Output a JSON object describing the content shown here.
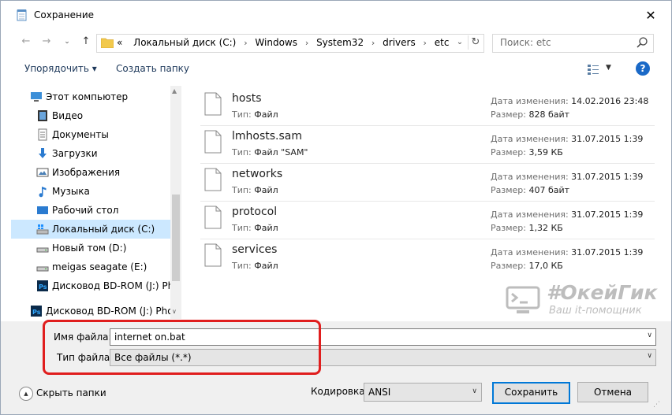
{
  "window": {
    "title": "Сохранение",
    "close_glyph": "✕"
  },
  "nav": {
    "back_glyph": "←",
    "forward_glyph": "→",
    "up_glyph": "↑",
    "breadcrumbs": [
      "«",
      "Локальный диск (C:)",
      "Windows",
      "System32",
      "drivers",
      "etc"
    ],
    "crumb_separator": "›",
    "refresh_glyph": "↻",
    "dropdown_glyph": "⌄",
    "search_placeholder": "Поиск: etc"
  },
  "toolbar": {
    "organize_label": "Упорядочить ▾",
    "new_folder_label": "Создать папку",
    "view_dropdown_glyph": "▼",
    "help_label": "?"
  },
  "sidebar": {
    "items": [
      {
        "label": "Этот компьютер",
        "icon": "computer-icon",
        "selected": false
      },
      {
        "label": "Видео",
        "icon": "video-folder-icon",
        "selected": false
      },
      {
        "label": "Документы",
        "icon": "documents-folder-icon",
        "selected": false
      },
      {
        "label": "Загрузки",
        "icon": "downloads-icon",
        "selected": false
      },
      {
        "label": "Изображения",
        "icon": "pictures-folder-icon",
        "selected": false
      },
      {
        "label": "Музыка",
        "icon": "music-icon",
        "selected": false
      },
      {
        "label": "Рабочий стол",
        "icon": "desktop-icon",
        "selected": false
      },
      {
        "label": "Локальный диск (C:)",
        "icon": "local-disk-icon",
        "selected": true
      },
      {
        "label": "Новый том (D:)",
        "icon": "drive-icon",
        "selected": false
      },
      {
        "label": "meigas seagate (E:)",
        "icon": "drive-icon",
        "selected": false
      },
      {
        "label": "Дисковод BD-ROM (J:) Phot",
        "icon": "photoshop-icon",
        "selected": false
      },
      {
        "label": "Дисковод BD-ROM (J:) Photo",
        "icon": "photoshop-icon",
        "selected": false
      }
    ],
    "scroll_up_glyph": "▲",
    "scroll_down_glyph": "∨"
  },
  "files": {
    "modified_label": "Дата изменения:",
    "size_label": "Размер:",
    "type_label": "Тип:",
    "items": [
      {
        "name": "hosts",
        "type": "Файл",
        "modified": "14.02.2016 23:48",
        "size": "828 байт"
      },
      {
        "name": "lmhosts.sam",
        "type": "Файл \"SAM\"",
        "modified": "31.07.2015 1:39",
        "size": "3,59 КБ"
      },
      {
        "name": "networks",
        "type": "Файл",
        "modified": "31.07.2015 1:39",
        "size": "407 байт"
      },
      {
        "name": "protocol",
        "type": "Файл",
        "modified": "31.07.2015 1:39",
        "size": "1,32 КБ"
      },
      {
        "name": "services",
        "type": "Файл",
        "modified": "31.07.2015 1:39",
        "size": "17,0 КБ"
      }
    ]
  },
  "watermark": {
    "title": "#ОкейГик",
    "subtitle": "Ваш it-помощник"
  },
  "form": {
    "filename_label": "Имя файла:",
    "filename_value": "internet on.bat",
    "filetype_label": "Тип файла:",
    "filetype_value": "Все файлы  (*.*)",
    "dropdown_glyph": "∨"
  },
  "footer": {
    "hide_folders_label": "Скрыть папки",
    "hide_folders_glyph": "▲",
    "encoding_label": "Кодировка:",
    "encoding_value": "ANSI",
    "dropdown_glyph": "∨",
    "save_label": "Сохранить",
    "cancel_label": "Отмена",
    "grip_glyph": "⋰"
  },
  "colors": {
    "selection": "#cce8ff",
    "highlight_box": "#e01e1e",
    "primary_button_border": "#0078d7",
    "help_button": "#1a69c7"
  }
}
